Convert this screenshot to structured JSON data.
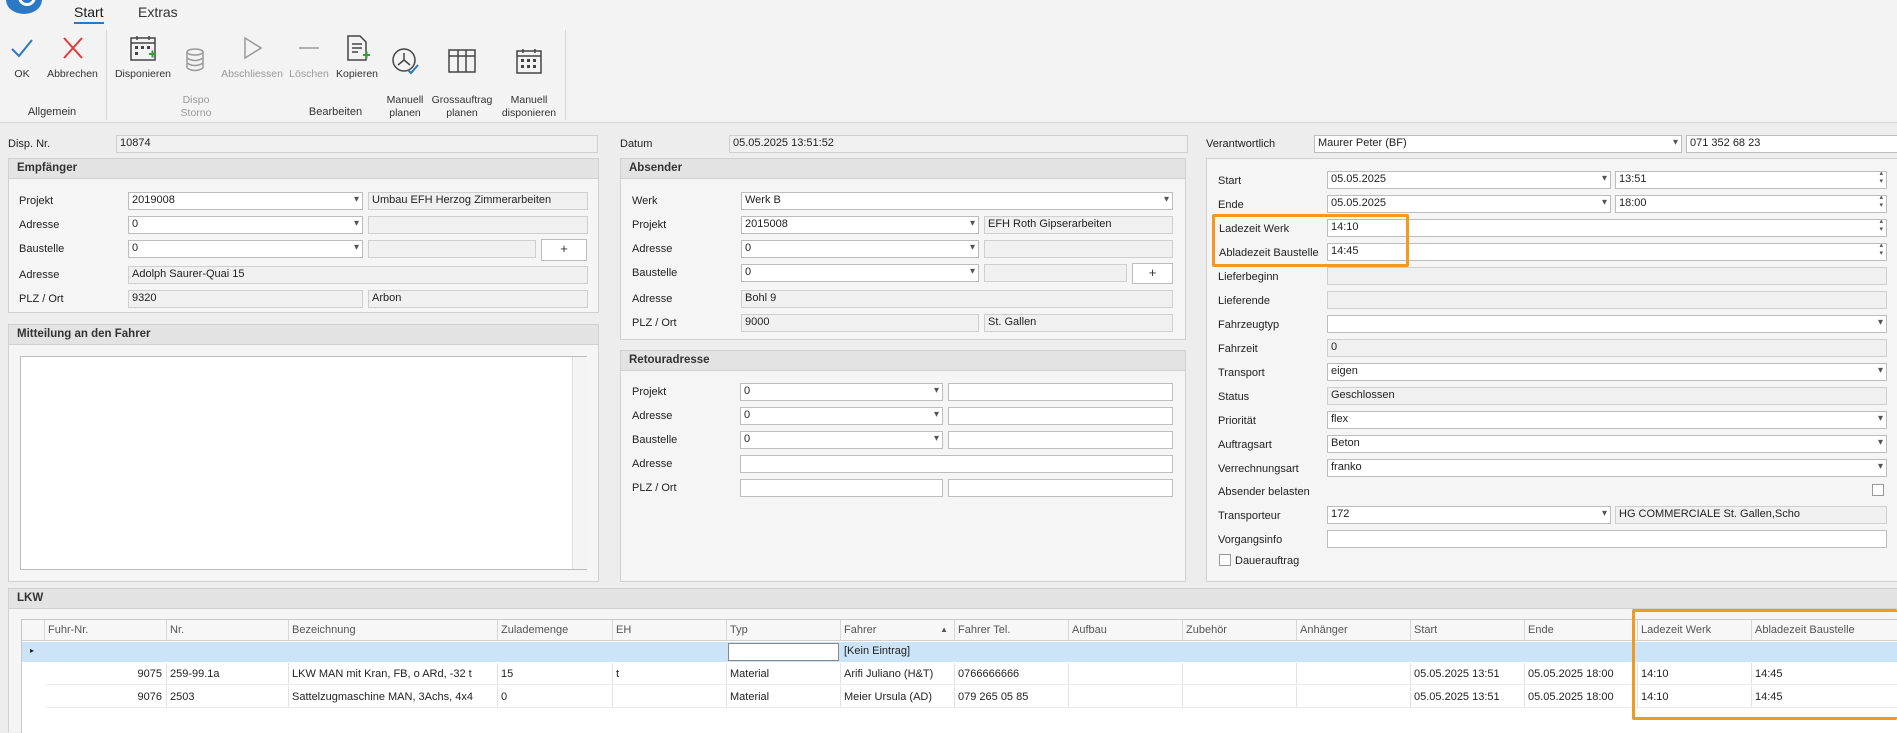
{
  "tabs": [
    "Start",
    "Extras"
  ],
  "ribbon": {
    "allgemein": {
      "label": "Allgemein",
      "ok": "OK",
      "abbrechen": "Abbrechen"
    },
    "bearbeiten": {
      "label": "Bearbeiten",
      "disponieren": "Disponieren",
      "dispo_storno": "Dispo\nStorno",
      "abschliessen": "Abschliessen",
      "loeschen": "Löschen",
      "kopieren": "Kopieren",
      "manuell_planen": "Manuell\nplanen",
      "grossauftrag_planen": "Grossauftrag\nplanen",
      "manuell_disponieren": "Manuell\ndisponieren"
    }
  },
  "header": {
    "disp_label": "Disp. Nr.",
    "disp_value": "10874",
    "datum_label": "Datum",
    "datum_value": "05.05.2025 13:51:52",
    "verantwortlich_label": "Verantwortlich",
    "verantwortlich_value": "Maurer Peter (BF)",
    "phone": "071 352 68 23"
  },
  "empfaenger": {
    "title": "Empfänger",
    "projekt_label": "Projekt",
    "projekt_value": "2019008",
    "projekt_desc": "Umbau EFH Herzog Zimmerarbeiten",
    "adresse_label": "Adresse",
    "adresse_value": "0",
    "baustelle_label": "Baustelle",
    "baustelle_value": "0",
    "plus": "+",
    "adresse2_label": "Adresse",
    "adresse2_value": "Adolph Saurer-Quai 15",
    "plz_label": "PLZ / Ort",
    "plz_value": "9320",
    "ort_value": "Arbon"
  },
  "mitteilung": {
    "title": "Mitteilung an den Fahrer"
  },
  "absender": {
    "title": "Absender",
    "werk_label": "Werk",
    "werk_value": "Werk B",
    "projekt_label": "Projekt",
    "projekt_value": "2015008",
    "projekt_desc": "EFH Roth Gipserarbeiten",
    "adresse_label": "Adresse",
    "adresse_value": "0",
    "baustelle_label": "Baustelle",
    "baustelle_value": "0",
    "plus": "+",
    "adresse2_label": "Adresse",
    "adresse2_value": "Bohl 9",
    "plz_label": "PLZ / Ort",
    "plz_value": "9000",
    "ort_value": "St. Gallen"
  },
  "retour": {
    "title": "Retouradresse",
    "projekt_label": "Projekt",
    "projekt_value": "0",
    "adresse_label": "Adresse",
    "adresse_value": "0",
    "baustelle_label": "Baustelle",
    "baustelle_value": "0",
    "adresse2_label": "Adresse",
    "plz_label": "PLZ / Ort"
  },
  "right": {
    "start_label": "Start",
    "start_date": "05.05.2025",
    "start_time": "13:51",
    "ende_label": "Ende",
    "ende_date": "05.05.2025",
    "ende_time": "18:00",
    "ladezeit_label": "Ladezeit Werk",
    "ladezeit_value": "14:10",
    "abladezeit_label": "Abladezeit Baustelle",
    "abladezeit_value": "14:45",
    "lieferbeginn_label": "Lieferbeginn",
    "lieferende_label": "Lieferende",
    "fahrzeugtyp_label": "Fahrzeugtyp",
    "fahrzeit_label": "Fahrzeit",
    "fahrzeit_value": "0",
    "transport_label": "Transport",
    "transport_value": "eigen",
    "status_label": "Status",
    "status_value": "Geschlossen",
    "prioritaet_label": "Priorität",
    "prioritaet_value": "flex",
    "auftragsart_label": "Auftragsart",
    "auftragsart_value": "Beton",
    "verrechnungsart_label": "Verrechnungsart",
    "verrechnungsart_value": "franko",
    "absender_belasten_label": "Absender belasten",
    "transporteur_label": "Transporteur",
    "transporteur_value": "172",
    "transporteur_desc": "HG COMMERCIALE St. Gallen,Scho",
    "vorgangsinfo_label": "Vorgangsinfo",
    "dauerauftrag_label": "Dauerauftrag"
  },
  "lkw": {
    "title": "LKW",
    "columns": [
      "Fuhr-Nr.",
      "Nr.",
      "Bezeichnung",
      "Zulademenge",
      "EH",
      "Typ",
      "Fahrer",
      "Fahrer Tel.",
      "Aufbau",
      "Zubehör",
      "Anhänger",
      "Start",
      "Ende",
      "Ladezeit Werk",
      "Abladezeit Baustelle"
    ],
    "placeholder": "[Kein Eintrag]",
    "rows": [
      [
        "9075",
        "259-99.1a",
        "LKW MAN mit Kran, FB, o ARd, -32 t",
        "15",
        "t",
        "Material",
        "Arifi Juliano (H&T)",
        "0766666666",
        "",
        "",
        "",
        "05.05.2025 13:51",
        "05.05.2025 18:00",
        "14:10",
        "14:45"
      ],
      [
        "9076",
        "2503",
        "Sattelzugmaschine MAN, 3Achs, 4x4",
        "0",
        "",
        "Material",
        "Meier Ursula (AD)",
        "079 265 05 85",
        "",
        "",
        "",
        "05.05.2025 13:51",
        "05.05.2025 18:00",
        "14:10",
        "14:45"
      ]
    ]
  },
  "colors": {
    "highlight": "#f29a1e",
    "accent": "#2b78c4",
    "selected_row": "#cce4f7"
  }
}
